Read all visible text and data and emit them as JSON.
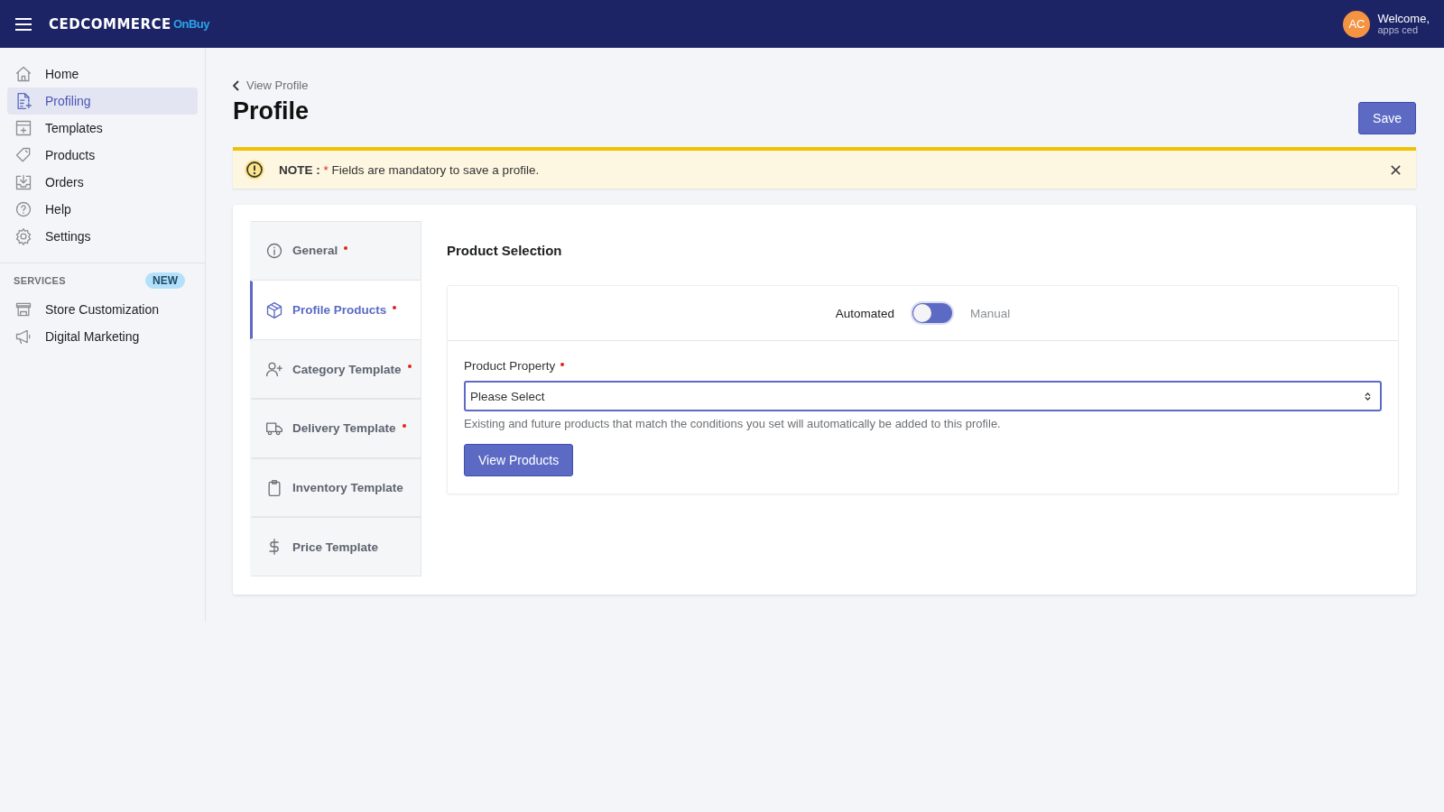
{
  "header": {
    "logo_main": "CEDCOMMERCE",
    "logo_sub": "OnBuy",
    "avatar": "AC",
    "welcome": "Welcome,",
    "user": "apps ced"
  },
  "sidebar": {
    "items": [
      {
        "label": "Home",
        "selected": false
      },
      {
        "label": "Profiling",
        "selected": true
      },
      {
        "label": "Templates",
        "selected": false
      },
      {
        "label": "Products",
        "selected": false
      },
      {
        "label": "Orders",
        "selected": false
      },
      {
        "label": "Help",
        "selected": false
      },
      {
        "label": "Settings",
        "selected": false
      }
    ],
    "section": {
      "title": "SERVICES",
      "badge": "NEW"
    },
    "services": [
      {
        "label": "Store Customization",
        "selected": false
      },
      {
        "label": "Digital Marketing",
        "selected": false
      }
    ]
  },
  "page": {
    "back": "View Profile",
    "title": "Profile",
    "save": "Save"
  },
  "note": {
    "label": "NOTE :",
    "star": "*",
    "text": "Fields are mandatory to save a profile."
  },
  "steps": [
    {
      "label": "General",
      "required": true,
      "selected": false
    },
    {
      "label": "Profile Products",
      "required": true,
      "selected": true
    },
    {
      "label": "Category Template",
      "required": true,
      "selected": false
    },
    {
      "label": "Delivery Template",
      "required": true,
      "selected": false
    },
    {
      "label": "Inventory Template",
      "required": false,
      "selected": false
    },
    {
      "label": "Price Template",
      "required": false,
      "selected": false
    }
  ],
  "panel": {
    "title": "Product Selection",
    "toggle": [
      {
        "label": "Automated",
        "selected": true
      },
      {
        "label": "Manual",
        "selected": false
      }
    ],
    "field": {
      "label": "Product Property",
      "required": true,
      "placeholder": "Please Select",
      "help": "Existing and future products that match the conditions you set will automatically be added to this profile."
    },
    "button": "View Products"
  }
}
